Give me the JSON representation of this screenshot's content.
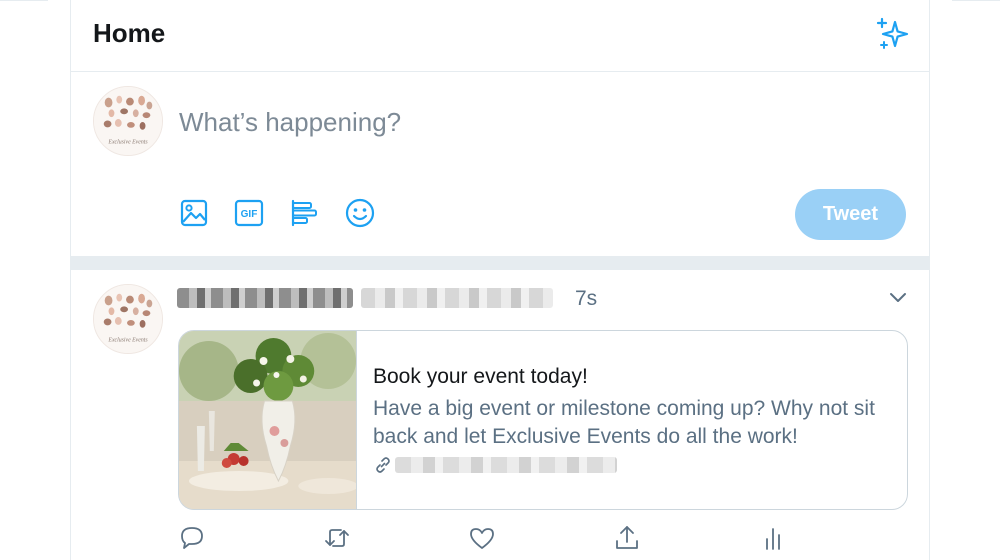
{
  "header": {
    "title": "Home",
    "sparkle_icon": "sparkle-icon",
    "accent_color": "#1da1f2"
  },
  "composer": {
    "placeholder": "What’s happening?",
    "tools": [
      "image-icon",
      "gif-icon",
      "poll-icon",
      "emoji-icon"
    ],
    "gif_label": "GIF",
    "tweet_button_label": "Tweet",
    "tweet_button_color": "#9ad0f6"
  },
  "avatar": {
    "caption": "Exclusive Events"
  },
  "tweet": {
    "time": "7s",
    "card": {
      "title": "Book your event today!",
      "description": "Have a big event or milestone coming up? Why not sit back and let Exclusive Events do all the work!"
    },
    "actions": [
      "reply-icon",
      "retweet-icon",
      "like-icon",
      "share-icon",
      "analytics-icon"
    ]
  }
}
